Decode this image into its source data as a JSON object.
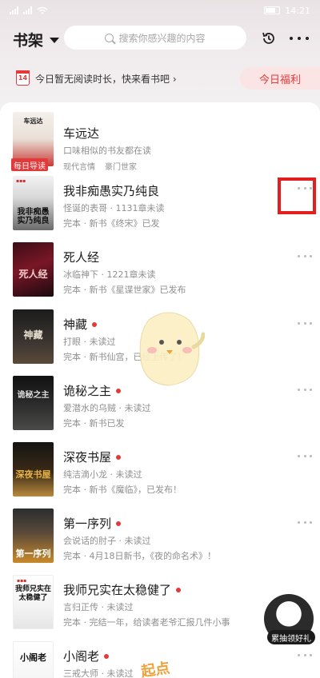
{
  "statusbar": {
    "time": "14:21"
  },
  "header": {
    "shelf_title": "书架",
    "search_placeholder": "搜索你感兴趣的内容"
  },
  "banner": {
    "calendar_day": "14",
    "text": "今日暂无阅读时长，快来看书吧",
    "welfare_label": "今日福利"
  },
  "books": [
    {
      "title": "车远达",
      "sub": "口味相似的书友都在读",
      "tags": [
        "现代言情",
        "豪门世家"
      ],
      "badge": "每日导读",
      "cover_text": "车远达"
    },
    {
      "title": "我非痴愚实乃纯良",
      "sub": "怪诞的表哥 · 1131章未读",
      "meta": "完本 · 新书《终宋》已发",
      "cover_text": "我非痴愚 实乃纯良"
    },
    {
      "title": "死人经",
      "sub": "冰临神下 · 1221章未读",
      "meta": "完本 · 新书《星谍世家》已发布",
      "cover_text": "死人经"
    },
    {
      "title": "神藏",
      "sub": "打眼 · 未读过",
      "meta": "完本 · 新书仙宫，已经上传了！",
      "cover_text": "神藏"
    },
    {
      "title": "诡秘之主",
      "sub": "爱潜水的乌贼 · 未读过",
      "meta": "完本 · 新书已发",
      "cover_text": "诡秘之主"
    },
    {
      "title": "深夜书屋",
      "sub": "纯洁滴小龙 · 未读过",
      "meta": "完本 · 新书《魔临》，已发布！",
      "cover_text": "深夜书屋"
    },
    {
      "title": "第一序列",
      "sub": "会说话的肘子 · 未读过",
      "meta": "完本 · 4月18日新书，《夜的命名术》！",
      "cover_text": "第一序列"
    },
    {
      "title": "我师兄实在太稳健了",
      "sub": "言归正传 · 未读过",
      "meta": "完本 · 完结一年，给读者老爷汇报几件小事",
      "cover_text": "我师兄实在 太稳健了"
    },
    {
      "title": "小阁老",
      "sub": "三戒大师 · 未读过",
      "cover_text": "小阁老"
    }
  ],
  "floating": {
    "gift_label": "累抽领好礼",
    "bottom_deco": "起点"
  },
  "colors": {
    "accent": "#e23a3a",
    "welfare_bg": "#fbe4e4"
  }
}
